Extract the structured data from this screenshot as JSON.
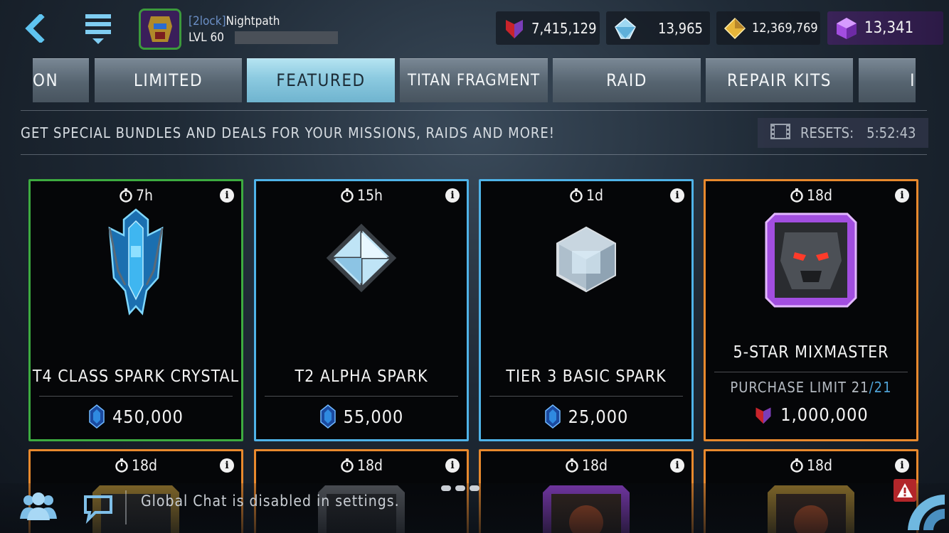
{
  "header": {
    "clan_tag": "[2lock]",
    "username": "Nightpath",
    "level": "LVL 60",
    "icons": {
      "back": "chevron-left-icon",
      "menu": "hamburger-menu-icon"
    }
  },
  "currencies": [
    {
      "icon": "autobot-badge-icon",
      "value": "7,415,129"
    },
    {
      "icon": "crystal-icon",
      "value": "13,965"
    },
    {
      "icon": "gold-ore-icon",
      "value": "12,369,769"
    },
    {
      "icon": "purple-cube-icon",
      "value": "13,341"
    }
  ],
  "tabs": [
    {
      "label": "ON"
    },
    {
      "label": "LIMITED"
    },
    {
      "label": "FEATURED",
      "active": true
    },
    {
      "label": "TITAN FRAGMENT"
    },
    {
      "label": "RAID"
    },
    {
      "label": "REPAIR KITS"
    },
    {
      "label": "I"
    }
  ],
  "subtitle": "GET SPECIAL BUNDLES AND DEALS FOR YOUR MISSIONS, RAIDS AND MORE!",
  "resets": {
    "label": "RESETS:",
    "time": "5:52:43",
    "icon": "film-strip-icon"
  },
  "cards": [
    {
      "timer": "7h",
      "title": "T4 CLASS SPARK CRYSTAL",
      "price": "450,000",
      "price_icon": "blue-crystal-icon",
      "border": "#3dab40",
      "image": "t4-spark-crystal-icon"
    },
    {
      "timer": "15h",
      "title": "T2 ALPHA SPARK",
      "price": "55,000",
      "price_icon": "blue-crystal-icon",
      "border": "#4fb3e8",
      "image": "alpha-spark-icon"
    },
    {
      "timer": "1d",
      "title": "TIER 3 BASIC SPARK",
      "price": "25,000",
      "price_icon": "blue-crystal-icon",
      "border": "#4fb3e8",
      "image": "basic-spark-cube-icon"
    },
    {
      "timer": "18d",
      "title": "5-STAR MIXMASTER",
      "limit_label": "PURCHASE LIMIT",
      "limit_current": "21",
      "limit_max": "/21",
      "price": "1,000,000",
      "price_icon": "autobot-badge-icon",
      "border": "#e8892d",
      "image": "mixmaster-portrait"
    }
  ],
  "cards_row2": [
    {
      "timer": "18d"
    },
    {
      "timer": "18d"
    },
    {
      "timer": "18d"
    },
    {
      "timer": "18d"
    }
  ],
  "chat": {
    "message": "Global Chat is disabled in settings.",
    "icons": {
      "friends": "friends-icon",
      "chat": "chat-bubble-icon",
      "alert": "warning-icon",
      "radar": "radar-icon"
    }
  },
  "colors": {
    "active_tab": "#8ccae0",
    "card_green": "#3dab40",
    "card_blue": "#4fb3e8",
    "card_orange": "#e8892d",
    "premium_purple": "#3a2358"
  }
}
